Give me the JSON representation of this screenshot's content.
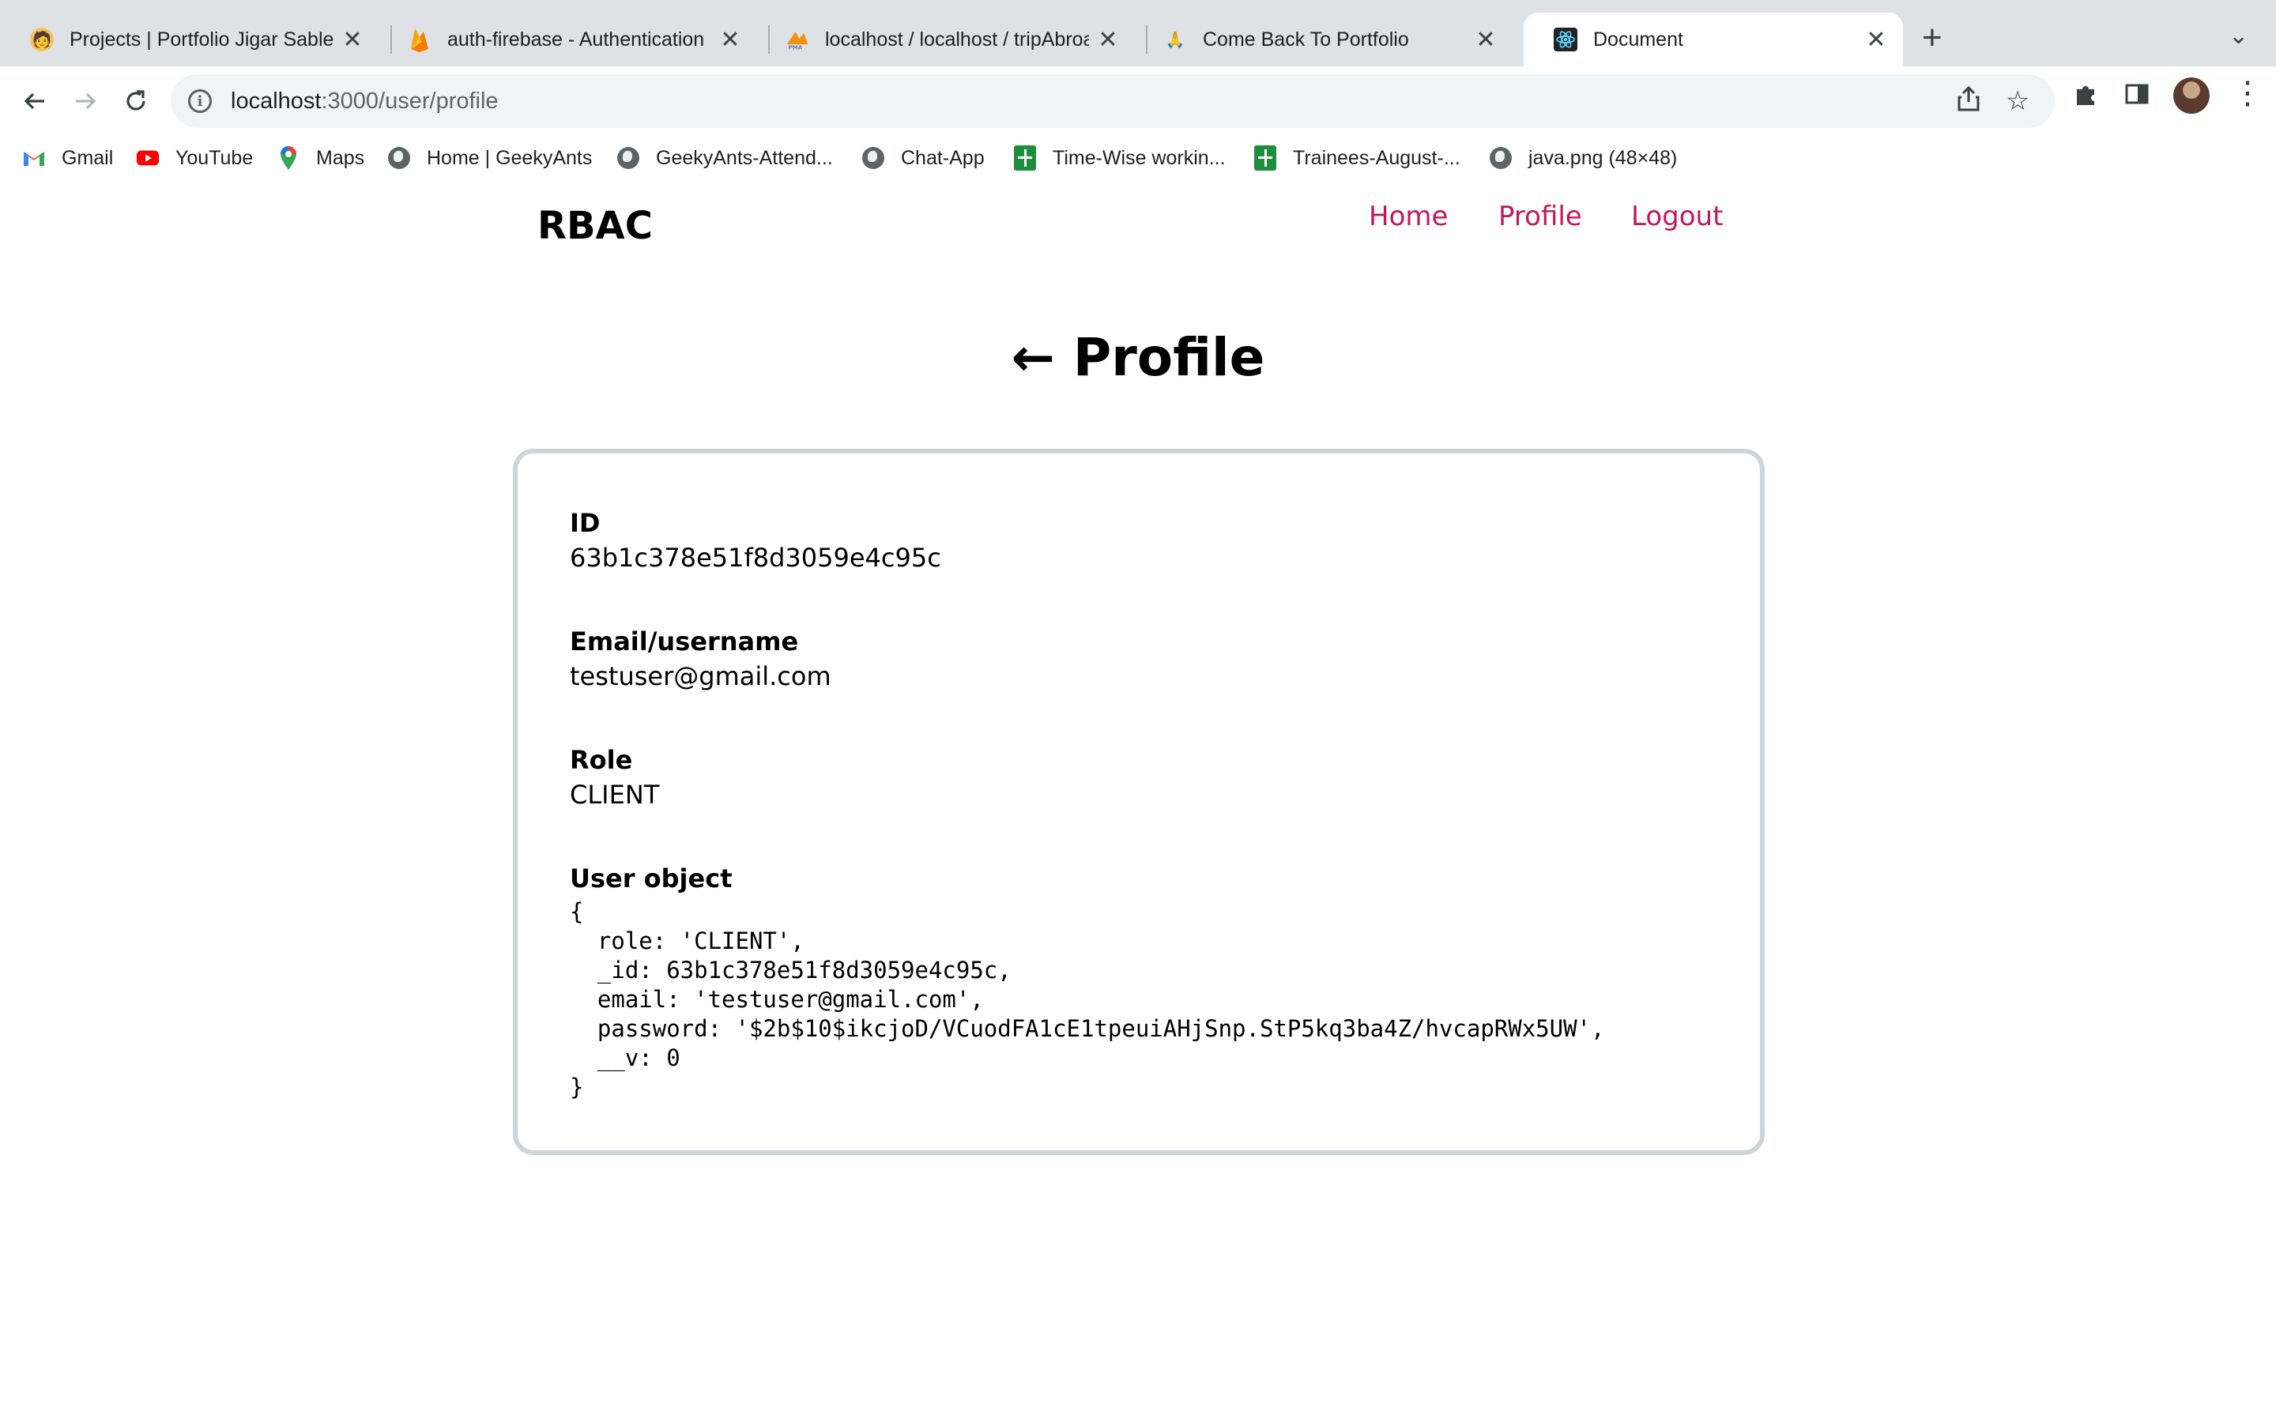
{
  "browser": {
    "tabs": [
      {
        "title": "Projects | Portfolio Jigar Sable",
        "icon": "portfolio-avatar-icon"
      },
      {
        "title": "auth-firebase - Authentication",
        "icon": "firebase-icon"
      },
      {
        "title": "localhost / localhost / tripAbroad",
        "icon": "phpmyadmin-icon"
      },
      {
        "title": "Come Back To Portfolio",
        "icon": "praying-hands-icon"
      },
      {
        "title": "Document",
        "icon": "react-icon",
        "active": true
      }
    ],
    "new_tab_symbol": "+",
    "close_symbol": "✕",
    "url_host": "localhost",
    "url_path": ":3000/user/profile",
    "bookmarks": [
      {
        "label": "Gmail",
        "icon": "gmail-icon"
      },
      {
        "label": "YouTube",
        "icon": "youtube-icon"
      },
      {
        "label": "Maps",
        "icon": "maps-icon"
      },
      {
        "label": "Home | GeekyAnts",
        "icon": "globe-icon"
      },
      {
        "label": "GeekyAnts-Attend...",
        "icon": "globe-icon"
      },
      {
        "label": "Chat-App",
        "icon": "globe-icon"
      },
      {
        "label": "Time-Wise workin...",
        "icon": "sheets-icon"
      },
      {
        "label": "Trainees-August-...",
        "icon": "sheets-icon"
      },
      {
        "label": "java.png (48×48)",
        "icon": "globe-icon"
      }
    ],
    "colors": {
      "tabstrip": "#dee1e6",
      "omnibox": "#f1f3f4"
    }
  },
  "app": {
    "brand": "RBAC",
    "nav": {
      "home": "Home",
      "profile": "Profile",
      "logout": "Logout"
    },
    "heading_arrow": "←",
    "heading": "Profile",
    "colors": {
      "nav_link": "#c2185b",
      "card_border": "#d0d4d9"
    }
  },
  "profile": {
    "id_label": "ID",
    "id_value": "63b1c378e51f8d3059e4c95c",
    "email_label": "Email/username",
    "email_value": "testuser@gmail.com",
    "role_label": "Role",
    "role_value": "CLIENT",
    "object_label": "User object",
    "object_text": "{\n  role: 'CLIENT',\n  _id: 63b1c378e51f8d3059e4c95c,\n  email: 'testuser@gmail.com',\n  password: '$2b$10$ikcjoD/VCuodFA1cE1tpeuiAHjSnp.StP5kq3ba4Z/hvcapRWx5UW',\n  __v: 0\n}"
  }
}
